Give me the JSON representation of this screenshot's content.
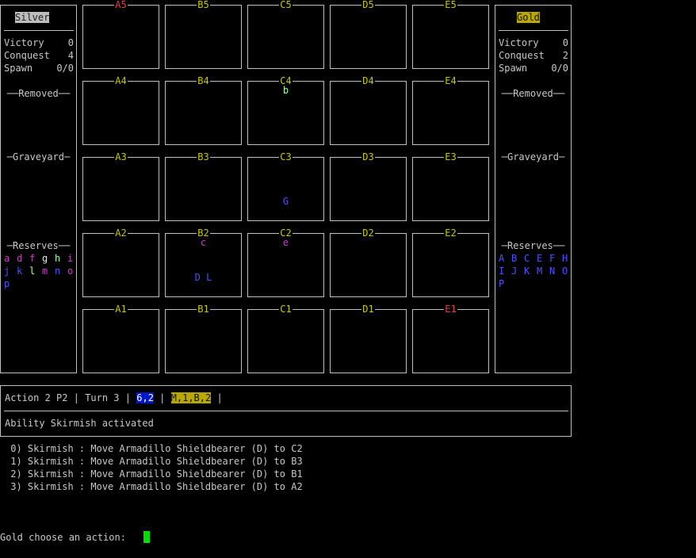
{
  "colors": {
    "yellow": "#c8c800",
    "red": "#e04040",
    "green": "#7cff7c",
    "magenta": "#c040c0",
    "blue": "#5050ff",
    "white": "#e8e8e8",
    "lightgreen": "#a0ffa0"
  },
  "silver": {
    "name": "Silver",
    "stats": [
      {
        "label": "Victory",
        "value": "0"
      },
      {
        "label": "Conquest",
        "value": "4"
      },
      {
        "label": "Spawn",
        "value": "0/0"
      }
    ],
    "removed_title": "Removed",
    "graveyard_title": "Graveyard",
    "reserves_title": "Reserves",
    "reserves": [
      [
        {
          "t": "a",
          "c": "magenta"
        },
        {
          "t": "d",
          "c": "magenta"
        },
        {
          "t": "f",
          "c": "magenta"
        },
        {
          "t": "g",
          "c": "white"
        },
        {
          "t": "h",
          "c": "lightgreen"
        },
        {
          "t": "i",
          "c": "magenta"
        }
      ],
      [
        {
          "t": "j",
          "c": "blue"
        },
        {
          "t": "k",
          "c": "blue"
        },
        {
          "t": "l",
          "c": "lightgreen"
        },
        {
          "t": "m",
          "c": "magenta"
        },
        {
          "t": "n",
          "c": "blue"
        },
        {
          "t": "o",
          "c": "magenta"
        }
      ],
      [
        {
          "t": "p",
          "c": "blue"
        }
      ]
    ]
  },
  "gold": {
    "name": "Gold",
    "stats": [
      {
        "label": "Victory",
        "value": "0"
      },
      {
        "label": "Conquest",
        "value": "2"
      },
      {
        "label": "Spawn",
        "value": "0/0"
      }
    ],
    "removed_title": "Removed",
    "graveyard_title": "Graveyard",
    "reserves_title": "Reserves",
    "reserves": [
      [
        {
          "t": "A",
          "c": "blue"
        },
        {
          "t": "B",
          "c": "blue"
        },
        {
          "t": "C",
          "c": "blue"
        },
        {
          "t": "E",
          "c": "blue"
        },
        {
          "t": "F",
          "c": "blue"
        },
        {
          "t": "H",
          "c": "blue"
        }
      ],
      [
        {
          "t": "I",
          "c": "blue"
        },
        {
          "t": "J",
          "c": "blue"
        },
        {
          "t": "K",
          "c": "blue"
        },
        {
          "t": "M",
          "c": "blue"
        },
        {
          "t": "N",
          "c": "blue"
        },
        {
          "t": "O",
          "c": "blue"
        }
      ],
      [
        {
          "t": "P",
          "c": "blue"
        }
      ]
    ]
  },
  "board": {
    "rows": [
      [
        {
          "id": "A5",
          "c": "red"
        },
        {
          "id": "B5",
          "c": "yellow"
        },
        {
          "id": "C5",
          "c": "yellow"
        },
        {
          "id": "D5",
          "c": "yellow"
        },
        {
          "id": "E5",
          "c": "yellow"
        }
      ],
      [
        {
          "id": "A4",
          "c": "yellow"
        },
        {
          "id": "B4",
          "c": "yellow"
        },
        {
          "id": "C4",
          "c": "yellow",
          "top": {
            "t": "b",
            "c": "lightgreen"
          }
        },
        {
          "id": "D4",
          "c": "yellow"
        },
        {
          "id": "E4",
          "c": "yellow"
        }
      ],
      [
        {
          "id": "A3",
          "c": "yellow"
        },
        {
          "id": "B3",
          "c": "yellow"
        },
        {
          "id": "C3",
          "c": "yellow",
          "bottom": {
            "t": "G",
            "c": "blue"
          }
        },
        {
          "id": "D3",
          "c": "yellow"
        },
        {
          "id": "E3",
          "c": "yellow"
        }
      ],
      [
        {
          "id": "A2",
          "c": "yellow"
        },
        {
          "id": "B2",
          "c": "yellow",
          "top": {
            "t": "c",
            "c": "magenta"
          },
          "bottom": {
            "t": "D L",
            "c": "blue"
          }
        },
        {
          "id": "C2",
          "c": "yellow",
          "top": {
            "t": "e",
            "c": "magenta"
          }
        },
        {
          "id": "D2",
          "c": "yellow"
        },
        {
          "id": "E2",
          "c": "yellow"
        }
      ],
      [
        {
          "id": "A1",
          "c": "yellow"
        },
        {
          "id": "B1",
          "c": "yellow"
        },
        {
          "id": "C1",
          "c": "yellow"
        },
        {
          "id": "D1",
          "c": "yellow"
        },
        {
          "id": "E1",
          "c": "red"
        }
      ]
    ]
  },
  "status": {
    "action": "Action 2 P2",
    "sep": "|",
    "turn": "Turn 3",
    "dice": "6,2",
    "move": "M,1,B,2",
    "message": "Ability Skirmish activated"
  },
  "options": [
    " 0) Skirmish : Move Armadillo Shieldbearer (D) to C2",
    " 1) Skirmish : Move Armadillo Shieldbearer (D) to B3",
    " 2) Skirmish : Move Armadillo Shieldbearer (D) to B1",
    " 3) Skirmish : Move Armadillo Shieldbearer (D) to A2"
  ],
  "prompt": "Gold choose an action: "
}
